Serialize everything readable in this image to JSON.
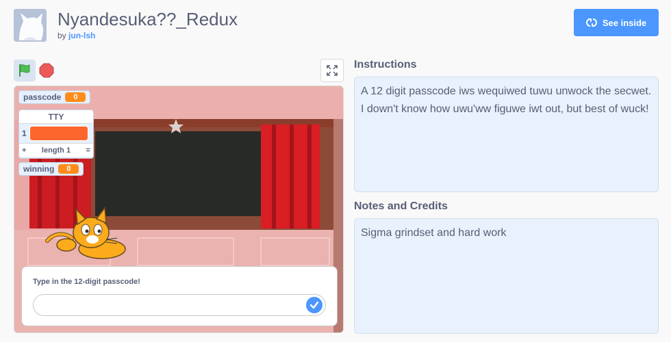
{
  "project": {
    "title": "Nyandesuka??_Redux",
    "by_label": "by",
    "author": "jun-lsh",
    "see_inside_label": "See inside"
  },
  "player": {
    "monitors": {
      "passcode_label": "passcode",
      "passcode_value": "0",
      "list_title": "TTY",
      "list_index": "1",
      "list_add": "+",
      "list_length": "length 1",
      "list_resize": "=",
      "winning_label": "winning",
      "winning_value": "0"
    },
    "ask": {
      "prompt": "Type in the 12-digit passcode!",
      "value": ""
    }
  },
  "instructions": {
    "heading": "Instructions",
    "text": "A 12 digit passcode iws wequiwed tuwu unwock the secwet. I down't know how uwu'ww figuwe iwt out, but best of wuck!"
  },
  "notes": {
    "heading": "Notes and Credits",
    "text": "Sigma grindset and hard work"
  },
  "colors": {
    "accent": "#4c97ff",
    "monitor_orange": "#ff8c1a",
    "list_orange": "#fc662c",
    "panel_bg": "#e9f1fc",
    "text": "#575e75"
  },
  "icons": {
    "flag": "green-flag-icon",
    "stop": "stop-icon",
    "fullscreen": "fullscreen-icon",
    "see_inside": "see-inside-icon",
    "submit": "checkmark-icon"
  }
}
